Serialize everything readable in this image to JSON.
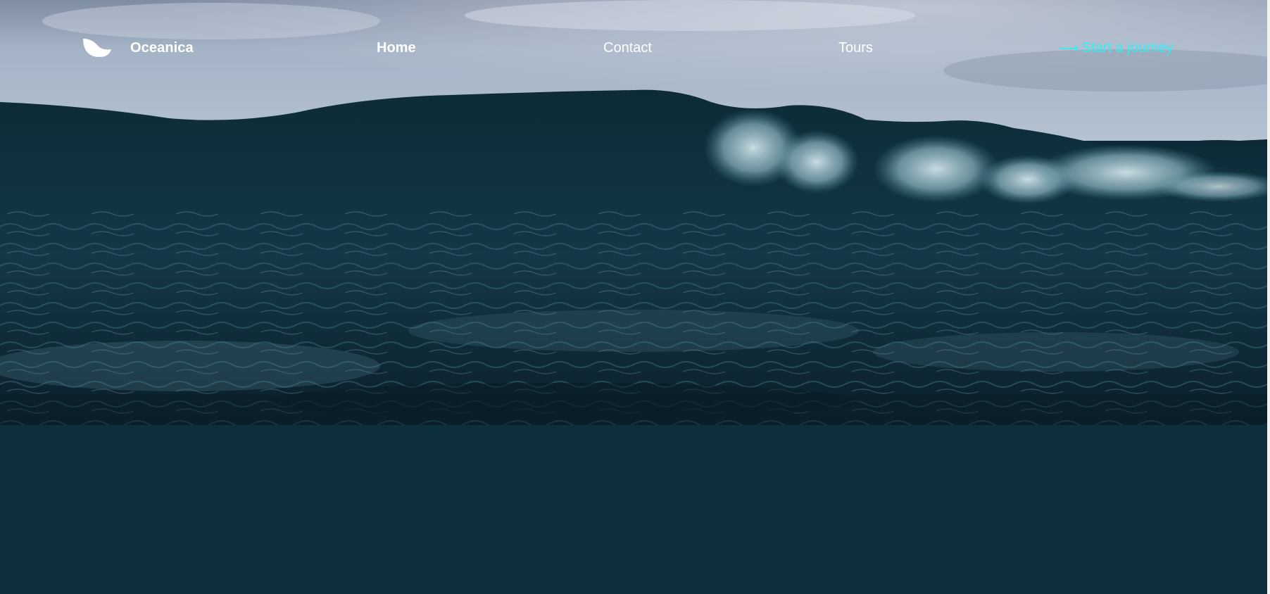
{
  "brand": {
    "name": "Oceanica",
    "logo_icon": "wave-leaf-icon"
  },
  "nav": {
    "items": [
      {
        "label": "Home",
        "active": true
      },
      {
        "label": "Contact",
        "active": false
      },
      {
        "label": "Tours",
        "active": false
      }
    ],
    "cta": {
      "arrow": "⟶",
      "label": "Start a journey"
    }
  },
  "colors": {
    "accent": "#2ef0f5",
    "page_background": "#0d2f3b",
    "text": "#ffffff"
  }
}
